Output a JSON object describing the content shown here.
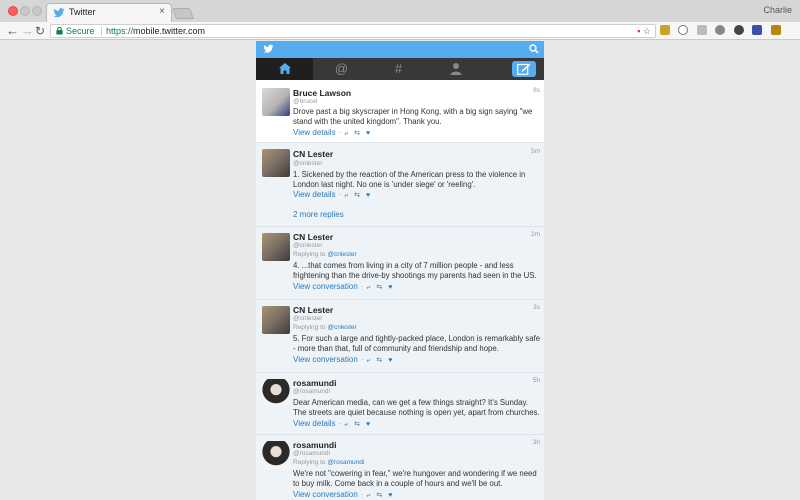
{
  "browser": {
    "tab_title": "Twitter",
    "tab_close": "×",
    "profile_name": "Charlie",
    "secure_label": "Secure",
    "url_scheme": "https://",
    "url_host": "mobile.twitter.com"
  },
  "twitter": {
    "nav": [
      "home-icon",
      "mentions-icon",
      "discover-icon",
      "profile-icon",
      "compose-icon"
    ],
    "brand_color": "#55acee",
    "more_replies": "2 more replies",
    "tweets": [
      {
        "name": "Bruce Lawson",
        "handle": "@brucel",
        "time": "8s",
        "reply_to_prefix": "",
        "reply_to": "",
        "text": "Drove past a big skyscraper in Hong Kong, with a big sign saying \"we stand with the united kingdom\". Thank you.",
        "action_link": "View details"
      },
      {
        "name": "CN Lester",
        "handle": "@cnlester",
        "time": "5m",
        "reply_to_prefix": "",
        "reply_to": "",
        "text": "1. Sickened by the reaction of the American press to the violence in London last night. No one is 'under siege' or 'reeling'.",
        "action_link": "View details"
      },
      {
        "name": "CN Lester",
        "handle": "@cnlester",
        "time": "2m",
        "reply_to_prefix": "Replying to",
        "reply_to": "@cnlester",
        "text": "4. ...that comes from living in a city of 7 million people - and less frightening than the drive-by shootings my parents had seen in the US.",
        "action_link": "View conversation"
      },
      {
        "name": "CN Lester",
        "handle": "@cnlester",
        "time": "3s",
        "reply_to_prefix": "Replying to",
        "reply_to": "@cnlester",
        "text": "5. For such a large and tightly-packed place, London is remarkably safe - more than that, full of community and friendship and hope.",
        "action_link": "View conversation"
      },
      {
        "name": "rosamundi",
        "handle": "@rosamundi",
        "time": "5h",
        "reply_to_prefix": "",
        "reply_to": "",
        "text": "Dear American media, can we get a few things straight? It's Sunday. The streets are quiet because nothing is open yet, apart from churches.",
        "action_link": "View details"
      },
      {
        "name": "rosamundi",
        "handle": "@rosamundi",
        "time": "3h",
        "reply_to_prefix": "Replying to",
        "reply_to": "@rosamundi",
        "text": "We're not \"cowering in fear,\" we're hungover and wondering if we need to buy milk. Come back in a couple of hours and we'll be out.",
        "action_link": "View conversation"
      }
    ]
  }
}
